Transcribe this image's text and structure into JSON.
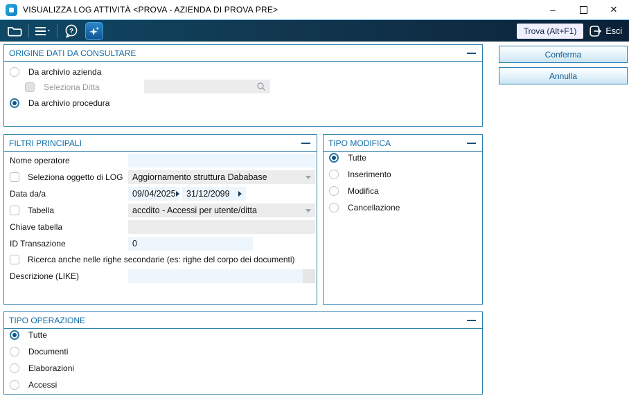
{
  "window": {
    "title": "VISUALIZZA LOG ATTIVITÀ <PROVA - AZIENDA DI PROVA PRE>",
    "minimize_glyph": "–",
    "close_glyph": "✕"
  },
  "toolbar": {
    "find_button": "Trova (Alt+F1)",
    "exit_label": "Esci",
    "help_glyph": "?",
    "icons": [
      "folder-icon",
      "menu-icon",
      "help-icon",
      "sparkle-icon",
      "exit-icon"
    ]
  },
  "actions": {
    "confirm": "Conferma",
    "cancel": "Annulla"
  },
  "groups": {
    "origine": {
      "title": "ORIGINE DATI DA CONSULTARE",
      "option_azienda": "Da archivio azienda",
      "option_procedura": "Da archivio procedura",
      "selected_option": "Da archivio procedura",
      "seleziona_ditta": {
        "label": "Seleziona Ditta",
        "checked": false,
        "value": "",
        "enabled": false
      }
    },
    "filtri": {
      "title": "FILTRI PRINCIPALI",
      "nome_operatore": {
        "label": "Nome operatore",
        "value": ""
      },
      "oggetto_log": {
        "label": "Seleziona oggetto di LOG",
        "checked": false,
        "value": "Aggiornamento struttura Dababase"
      },
      "data": {
        "label": "Data da/a",
        "from": "09/04/2025",
        "to": "31/12/2099"
      },
      "tabella": {
        "label": "Tabella",
        "checked": false,
        "value": "accdito - Accessi per utente/ditta"
      },
      "chiave_tabella": {
        "label": "Chiave tabella",
        "value": ""
      },
      "id_transazione": {
        "label": "ID Transazione",
        "value": "0"
      },
      "righe_secondarie": {
        "label": "Ricerca anche nelle righe secondarie (es: righe del corpo dei documenti)",
        "checked": false
      },
      "descrizione": {
        "label": "Descrizione (LIKE)",
        "value": ""
      }
    },
    "tipo_modifica": {
      "title": "TIPO MODIFICA",
      "options": [
        "Tutte",
        "Inserimento",
        "Modifica",
        "Cancellazione"
      ],
      "selected": "Tutte"
    },
    "tipo_operazione": {
      "title": "TIPO OPERAZIONE",
      "options": [
        "Tutte",
        "Documenti",
        "Elaborazioni",
        "Accessi"
      ],
      "selected": "Tutte"
    }
  },
  "colors": {
    "accent_blue": "#0d6ca6",
    "group_border": "#2e7fac",
    "toolbar_left": "#0e4866",
    "toolbar_right": "#0a2138",
    "input_blue": "#edf6fc",
    "input_gray": "#ececec",
    "radio_ring": "#2a77a8",
    "radio_dot": "#174f7c",
    "app_icon_blue": "#1b96d4"
  }
}
